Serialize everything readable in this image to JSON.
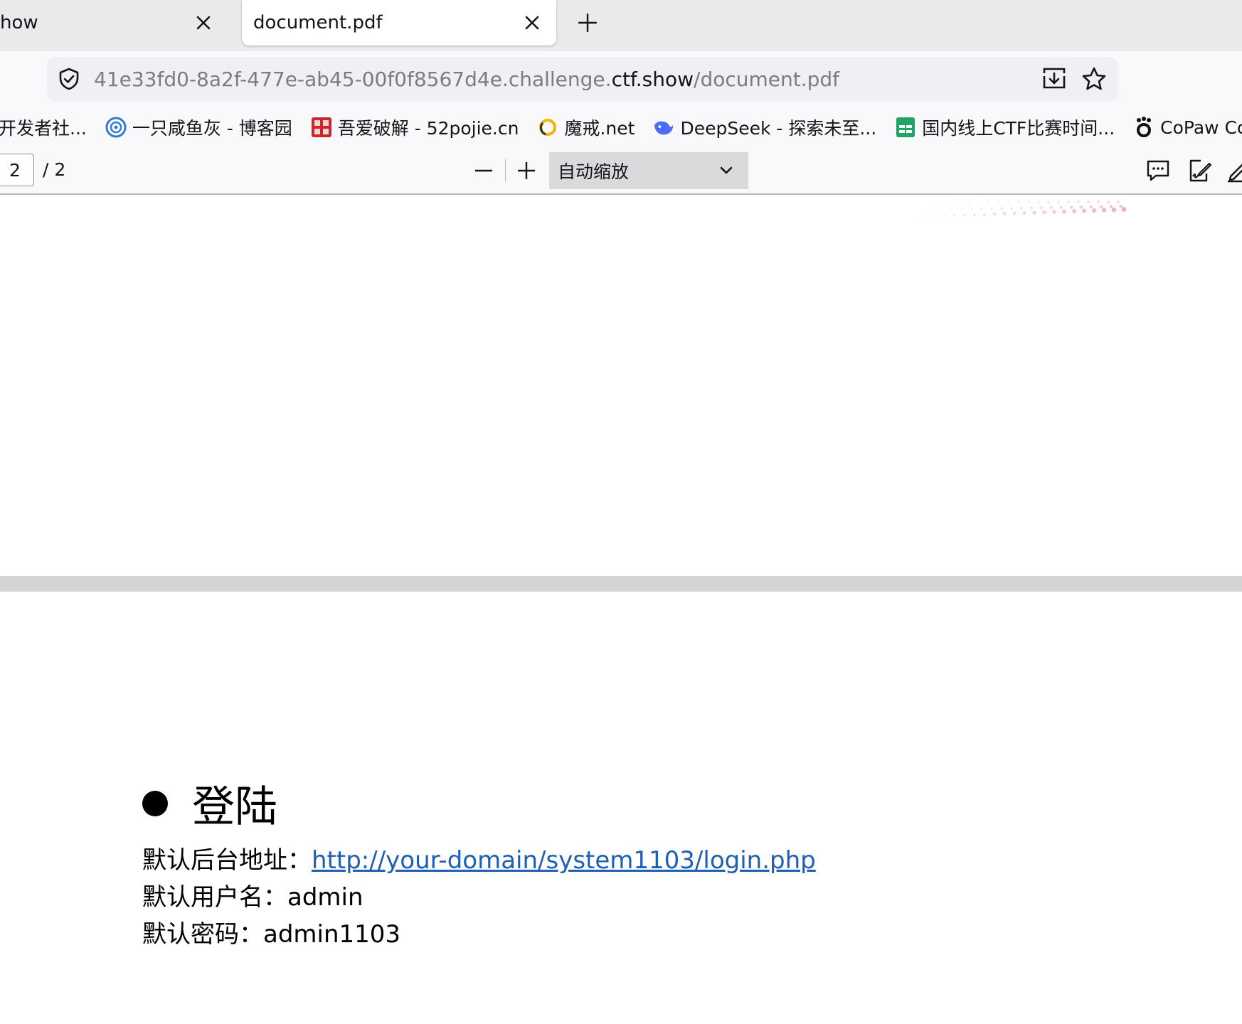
{
  "tabs": [
    {
      "title": "how",
      "active": false
    },
    {
      "title": "document.pdf",
      "active": true
    }
  ],
  "navbar": {
    "url_prefix": "41e33fd0-8a2f-477e-ab45-00f0f8567d4e.challenge.",
    "url_host": "ctf.show",
    "url_path": "/document.pdf"
  },
  "bookmarks": [
    {
      "label": "开发者社...",
      "icon": "none"
    },
    {
      "label": "一只咸鱼灰 - 博客园",
      "icon": "cnblogs-icon"
    },
    {
      "label": "吾爱破解 - 52pojie.cn",
      "icon": "52pojie-icon"
    },
    {
      "label": "魔戒.net",
      "icon": "ring-icon"
    },
    {
      "label": "DeepSeek - 探索未至...",
      "icon": "deepseek-icon"
    },
    {
      "label": "国内线上CTF比赛时间...",
      "icon": "sheet-icon"
    },
    {
      "label": "CoPaw Console",
      "icon": "copaw-icon"
    }
  ],
  "pdf_toolbar": {
    "page_number": "2",
    "page_total": "/ 2",
    "zoom_label": "自动缩放"
  },
  "document": {
    "heading": "登陆",
    "line1_label": "默认后台地址：",
    "line1_link": "http://your-domain/system1103/login.php",
    "line2": "默认用户名：admin",
    "line3": "默认密码：admin1103"
  },
  "colors": {
    "link": "#1f5fb4",
    "tabstrip": "#eaeaed",
    "urlbar": "#f0f0f4"
  }
}
